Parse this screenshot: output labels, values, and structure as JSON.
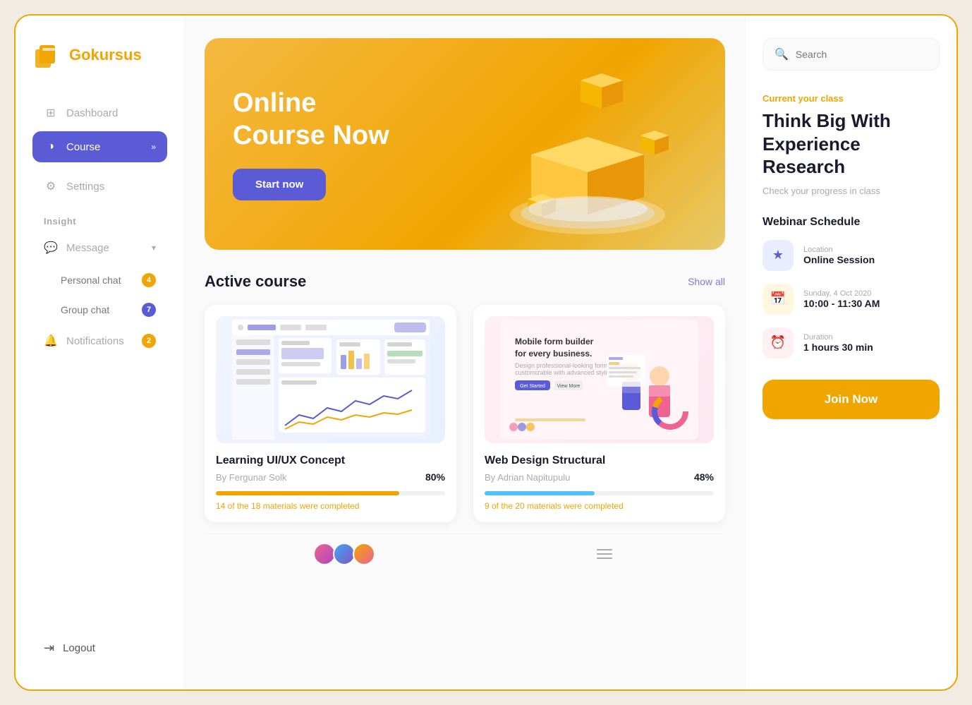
{
  "app": {
    "name": "Gokursus",
    "logo_emoji": "📚"
  },
  "sidebar": {
    "nav_items": [
      {
        "id": "dashboard",
        "label": "Dashboard",
        "icon": "⊞",
        "active": false
      },
      {
        "id": "course",
        "label": "Course",
        "icon": "◑",
        "active": true,
        "arrow": "»"
      }
    ],
    "settings_label": "Settings",
    "settings_icon": "⚙",
    "insight_label": "Insight",
    "message_label": "Message",
    "message_icon": "💬",
    "message_arrow": "▾",
    "personal_chat_label": "Personal chat",
    "personal_chat_badge": "4",
    "group_chat_label": "Group chat",
    "group_chat_badge": "7",
    "notifications_label": "Notifications",
    "notifications_icon": "🔔",
    "notifications_badge": "2",
    "logout_label": "Logout",
    "logout_icon": "⇥"
  },
  "hero": {
    "title_line1": "Online",
    "title_line2": "Course Now",
    "button_label": "Start now"
  },
  "active_course": {
    "section_title": "Active course",
    "show_all_label": "Show all",
    "courses": [
      {
        "id": "course-1",
        "title": "Learning UI/UX Concept",
        "author": "By Fergunar Solk",
        "progress": 80,
        "progress_label": "80%",
        "materials_completed": "14 of the 18 materials were completed",
        "color": "yellow"
      },
      {
        "id": "course-2",
        "title": "Web Design Structural",
        "author": "By Adrian Napitupulu",
        "progress": 48,
        "progress_label": "48%",
        "materials_completed": "9 of the 20 materials were completed",
        "color": "blue"
      }
    ]
  },
  "right_panel": {
    "search_placeholder": "Search",
    "current_class_label": "Current your class",
    "class_title": "Think Big With Experience Research",
    "class_description": "Check your progress in class",
    "webinar_title": "Webinar Schedule",
    "webinar_items": [
      {
        "id": "location",
        "label": "Location",
        "value": "Online Session",
        "icon": "★",
        "icon_bg": "blue"
      },
      {
        "id": "date",
        "label": "Sunday, 4 Oct 2020",
        "value": "10:00 - 11:30 AM",
        "icon": "📅",
        "icon_bg": "yellow"
      },
      {
        "id": "duration",
        "label": "Duration",
        "value": "1 hours 30 min",
        "icon": "⏰",
        "icon_bg": "pink"
      }
    ],
    "join_button_label": "Join Now"
  }
}
